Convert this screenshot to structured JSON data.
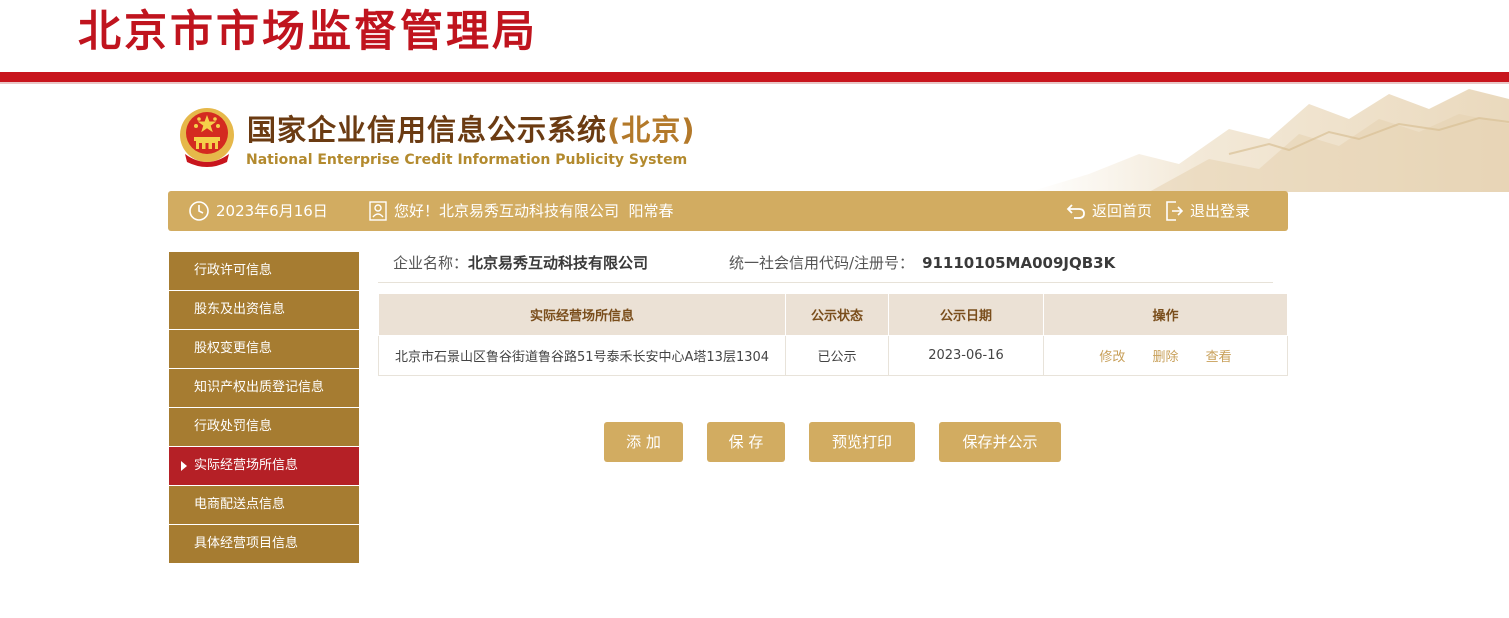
{
  "header": {
    "org_title": "北京市市场监督管理局",
    "system_title": "国家企业信用信息公示系统",
    "system_region": "(北京)",
    "system_subtitle": "National Enterprise Credit Information Publicity System"
  },
  "infobar": {
    "date": "2023年6月16日",
    "greeting": "您好！北京易秀互动科技有限公司  阳常春",
    "home_link": "返回首页",
    "logout_link": "退出登录"
  },
  "sidebar": {
    "items": [
      {
        "label": "行政许可信息",
        "active": false
      },
      {
        "label": "股东及出资信息",
        "active": false
      },
      {
        "label": "股权变更信息",
        "active": false
      },
      {
        "label": "知识产权出质登记信息",
        "active": false
      },
      {
        "label": "行政处罚信息",
        "active": false
      },
      {
        "label": "实际经营场所信息",
        "active": true
      },
      {
        "label": "电商配送点信息",
        "active": false
      },
      {
        "label": "具体经营项目信息",
        "active": false
      }
    ]
  },
  "company": {
    "name_label": "企业名称：",
    "name_value": "北京易秀互动科技有限公司",
    "code_label": "统一社会信用代码/注册号：",
    "code_value": "91110105MA009JQB3K"
  },
  "table": {
    "headers": [
      "实际经营场所信息",
      "公示状态",
      "公示日期",
      "操作"
    ],
    "rows": [
      {
        "address": "北京市石景山区鲁谷街道鲁谷路51号泰禾长安中心A塔13层1304",
        "status": "已公示",
        "date": "2023-06-16",
        "ops": [
          "修改",
          "删除",
          "查看"
        ]
      }
    ]
  },
  "buttons": {
    "add": "添 加",
    "save": "保 存",
    "preview_print": "预览打印",
    "save_publish": "保存并公示"
  },
  "colors": {
    "brand_red": "#c8151d",
    "gold": "#d2ac61",
    "sidebar_brown": "#a67c31",
    "active_red": "#b52026"
  }
}
